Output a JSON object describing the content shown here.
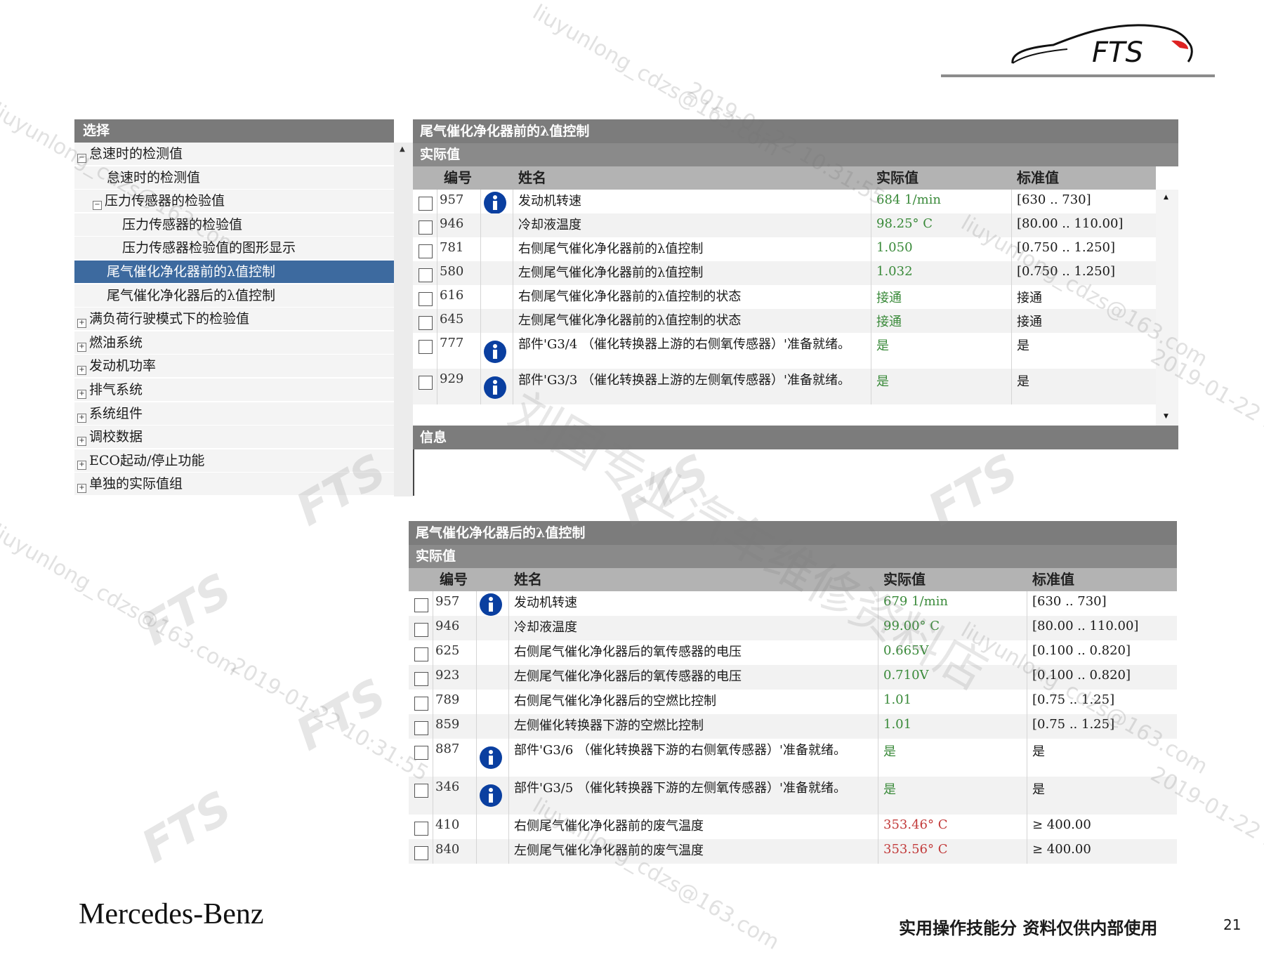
{
  "tree": {
    "header": "选择",
    "items": [
      {
        "label": "怠速时的检测值",
        "toggle": "−"
      },
      {
        "label": "怠速时的检测值",
        "toggle": ""
      },
      {
        "label": "压力传感器的检验值",
        "toggle": "−"
      },
      {
        "label": "压力传感器的检验值",
        "toggle": ""
      },
      {
        "label": "压力传感器检验值的图形显示",
        "toggle": ""
      },
      {
        "label": "尾气催化净化器前的λ值控制",
        "toggle": ""
      },
      {
        "label": "尾气催化净化器后的λ值控制",
        "toggle": ""
      },
      {
        "label": "满负荷行驶模式下的检验值",
        "toggle": "+"
      },
      {
        "label": "燃油系统",
        "toggle": "+"
      },
      {
        "label": "发动机功率",
        "toggle": "+"
      },
      {
        "label": "排气系统",
        "toggle": "+"
      },
      {
        "label": "系统组件",
        "toggle": "+"
      },
      {
        "label": "调校数据",
        "toggle": "+"
      },
      {
        "label": "ECO起动/停止功能",
        "toggle": "+"
      },
      {
        "label": "单独的实际值组",
        "toggle": "+"
      }
    ]
  },
  "columns": {
    "num": "编号",
    "name": "姓名",
    "actual": "实际值",
    "standard": "标准值"
  },
  "panel1": {
    "title": "尾气催化净化器前的λ值控制",
    "subtitle": "实际值",
    "info_label": "信息",
    "rows": [
      {
        "num": "957",
        "name": "发动机转速",
        "actual": "684 1/min",
        "standard": "[630 .. 730]",
        "info": true,
        "tall": false,
        "actual_color": "green"
      },
      {
        "num": "946",
        "name": "冷却液温度",
        "actual": "98.25° C",
        "standard": "[80.00 .. 110.00]",
        "info": false,
        "tall": false,
        "actual_color": "green"
      },
      {
        "num": "781",
        "name": "右侧尾气催化净化器前的λ值控制",
        "actual": "1.050",
        "standard": "[0.750 .. 1.250]",
        "info": false,
        "tall": false,
        "actual_color": "green"
      },
      {
        "num": "580",
        "name": "左侧尾气催化净化器前的λ值控制",
        "actual": "1.032",
        "standard": "[0.750 .. 1.250]",
        "info": false,
        "tall": false,
        "actual_color": "green"
      },
      {
        "num": "616",
        "name": "右侧尾气催化净化器前的λ值控制的状态",
        "actual": "接通",
        "standard": "接通",
        "info": false,
        "tall": false,
        "actual_color": "green"
      },
      {
        "num": "645",
        "name": "左侧尾气催化净化器前的λ值控制的状态",
        "actual": "接通",
        "standard": "接通",
        "info": false,
        "tall": false,
        "actual_color": "green"
      },
      {
        "num": "777",
        "name": "部件'G3/4 （催化转换器上游的右侧氧传感器）'准备就绪。",
        "actual": "是",
        "standard": "是",
        "info": true,
        "tall": true,
        "actual_color": "green"
      },
      {
        "num": "929",
        "name": "部件'G3/3 （催化转换器上游的左侧氧传感器）'准备就绪。",
        "actual": "是",
        "standard": "是",
        "info": true,
        "tall": true,
        "actual_color": "green"
      }
    ]
  },
  "panel2": {
    "title": "尾气催化净化器后的λ值控制",
    "subtitle": "实际值",
    "rows": [
      {
        "num": "957",
        "name": "发动机转速",
        "actual": "679 1/min",
        "standard": "[630 .. 730]",
        "info": true,
        "tall": false,
        "actual_color": "green"
      },
      {
        "num": "946",
        "name": "冷却液温度",
        "actual": "99.00° C",
        "standard": "[80.00 .. 110.00]",
        "info": false,
        "tall": false,
        "actual_color": "green"
      },
      {
        "num": "625",
        "name": "右侧尾气催化净化器后的氧传感器的电压",
        "actual": "0.665V",
        "standard": "[0.100 .. 0.820]",
        "info": false,
        "tall": false,
        "actual_color": "green"
      },
      {
        "num": "923",
        "name": "左侧尾气催化净化器后的氧传感器的电压",
        "actual": "0.710V",
        "standard": "[0.100 .. 0.820]",
        "info": false,
        "tall": false,
        "actual_color": "green"
      },
      {
        "num": "789",
        "name": "右侧尾气催化净化器后的空燃比控制",
        "actual": "1.01",
        "standard": "[0.75 .. 1.25]",
        "info": false,
        "tall": false,
        "actual_color": "green"
      },
      {
        "num": "859",
        "name": "左侧催化转换器下游的空燃比控制",
        "actual": "1.01",
        "standard": "[0.75 .. 1.25]",
        "info": false,
        "tall": false,
        "actual_color": "green"
      },
      {
        "num": "887",
        "name": "部件'G3/6 （催化转换器下游的右侧氧传感器）'准备就绪。",
        "actual": "是",
        "standard": "是",
        "info": true,
        "tall": true,
        "actual_color": "green"
      },
      {
        "num": "346",
        "name": "部件'G3/5 （催化转换器下游的左侧氧传感器）'准备就绪。",
        "actual": "是",
        "standard": "是",
        "info": true,
        "tall": true,
        "actual_color": "green"
      },
      {
        "num": "410",
        "name": "右侧尾气催化净化器前的废气温度",
        "actual": "353.46° C",
        "standard": "≥ 400.00",
        "info": false,
        "tall": false,
        "actual_color": "red"
      },
      {
        "num": "840",
        "name": "左侧尾气催化净化器前的废气温度",
        "actual": "353.56° C",
        "standard": "≥ 400.00",
        "info": false,
        "tall": false,
        "actual_color": "red"
      }
    ]
  },
  "logo": {
    "text": "FTS"
  },
  "footer": {
    "brand": "Mercedes-Benz",
    "note": "实用操作技能分 资料仅供内部使用",
    "page": "21"
  },
  "watermarks": {
    "email": "liuyunlong_cdzs@163.com",
    "datetime": "2019-01-22 10:31:55",
    "shop": "刘国专业汽车维修资料店",
    "brand": "FTS"
  },
  "colors": {
    "green": "#3a8a3a",
    "red": "#c23a3a",
    "selection": "#3d6a9f",
    "header": "#7c7c7c"
  }
}
